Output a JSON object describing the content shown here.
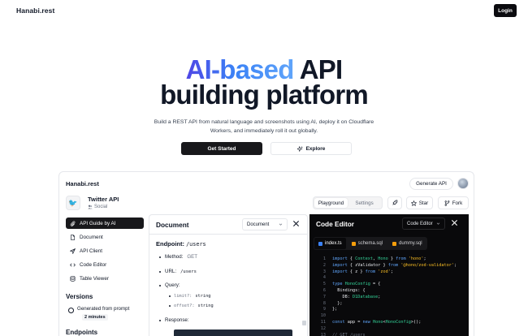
{
  "nav": {
    "brand": "Hanabi.rest",
    "login_label": "Login"
  },
  "hero": {
    "title_highlight": "AI-based",
    "title_rest": " API",
    "title_line2": "building platform",
    "description": "Build a REST API from natural language and screenshots using AI, deploy it on Cloudflare Workers, and immediately roll it out globally.",
    "primary_cta": "Get Started",
    "secondary_cta": "Explore"
  },
  "app": {
    "title": "Hanabi.rest",
    "generate_label": "Generate API",
    "project": {
      "name": "Twitter API",
      "category": "Social"
    },
    "tabs": [
      {
        "label": "Playground",
        "active": true
      },
      {
        "label": "Settings",
        "active": false
      }
    ],
    "star_label": "Star",
    "fork_label": "Fork",
    "sidebar": [
      {
        "label": "API Guide by AI",
        "icon": "paperclip-icon",
        "active": true
      },
      {
        "label": "Document",
        "icon": "file-icon",
        "active": false
      },
      {
        "label": "API Client",
        "icon": "send-icon",
        "active": false
      },
      {
        "label": "Code Editor",
        "icon": "code-icon",
        "active": false
      },
      {
        "label": "Table Viewer",
        "icon": "database-icon",
        "active": false
      }
    ],
    "versions_title": "Versions",
    "version": {
      "label": "Generated from prompt",
      "time": "2 minutes"
    },
    "endpoints_title": "Endpoints"
  },
  "document": {
    "title": "Document",
    "select_label": "Document",
    "endpoint_label": "Endpoint: ",
    "endpoint_path": "/users",
    "method_label": "Method: ",
    "method_value": "GET",
    "url_label": "URL: ",
    "url_value": "/users",
    "query_label": "Query:",
    "params": [
      {
        "name": "limit?:",
        "type": "string"
      },
      {
        "name": "offset?:",
        "type": "string"
      }
    ],
    "response_label": "Response:"
  },
  "editor": {
    "title": "Code Editor",
    "select_label": "Code Editor",
    "tabs": [
      {
        "label": "index.ts",
        "active": true,
        "color": "#3b82f6"
      },
      {
        "label": "schema.sql",
        "active": false,
        "color": "#f59e0b"
      },
      {
        "label": "dummy.sql",
        "active": false,
        "color": "#f59e0b"
      }
    ],
    "line_numbers": [
      "1",
      "2",
      "3",
      "4",
      "5",
      "6",
      "7",
      "8",
      "9",
      "10",
      "11",
      "12",
      "13"
    ],
    "code_lines": [
      "import { Context, Hono } from 'hono';",
      "import { zValidator } from '@hono/zod-validator';",
      "import { z } from 'zod';",
      "",
      "type HonoConfig = {",
      "  Bindings: {",
      "    DB: D1Database;",
      "  };",
      "};",
      "",
      "const app = new Hono<HonoConfig>();",
      "",
      "// GET /users"
    ]
  }
}
